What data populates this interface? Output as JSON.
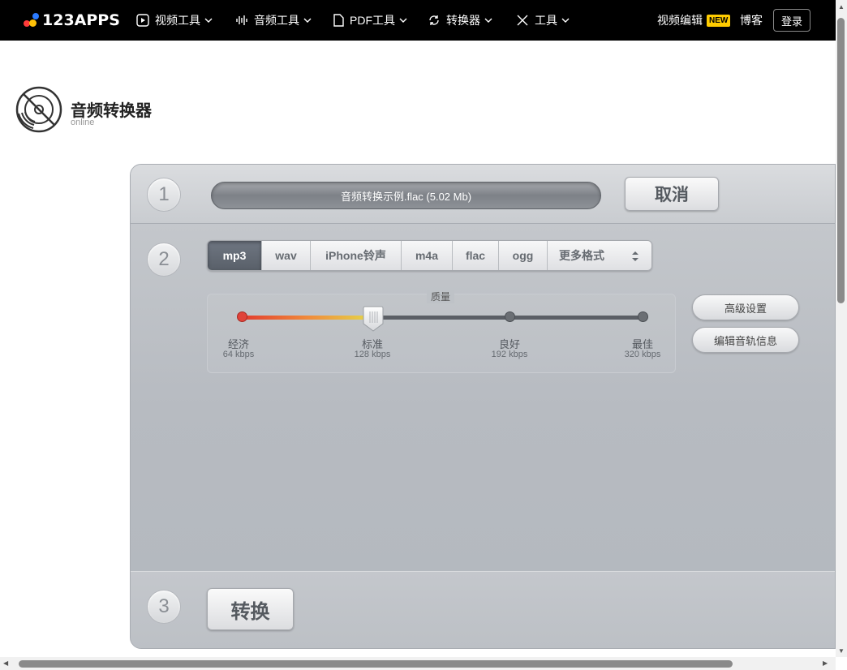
{
  "nav": {
    "logo": "123APPS",
    "items": [
      {
        "label": "视频工具",
        "icon": "play-icon"
      },
      {
        "label": "音频工具",
        "icon": "waveform-icon"
      },
      {
        "label": "PDF工具",
        "icon": "document-icon"
      },
      {
        "label": "转换器",
        "icon": "convert-icon"
      },
      {
        "label": "工具",
        "icon": "tools-icon"
      }
    ],
    "video_editor": "视频编辑",
    "new_badge": "NEW",
    "blog": "博客",
    "login": "登录"
  },
  "app": {
    "title": "音频转换器",
    "subtitle": "online"
  },
  "steps": {
    "s1": "1",
    "s2": "2",
    "s3": "3"
  },
  "file": {
    "name": "音频转换示例.flac (5.02 Mb)",
    "cancel_label": "取消"
  },
  "formats": {
    "items": [
      "mp3",
      "wav",
      "iPhone铃声",
      "m4a",
      "flac",
      "ogg",
      "更多格式"
    ],
    "selected": "mp3"
  },
  "quality": {
    "label": "质量",
    "levels": [
      {
        "name": "经济",
        "rate": "64 kbps"
      },
      {
        "name": "标准",
        "rate": "128 kbps"
      },
      {
        "name": "良好",
        "rate": "192 kbps"
      },
      {
        "name": "最佳",
        "rate": "320 kbps"
      }
    ],
    "selected_index": 1
  },
  "settings": {
    "advanced": "高级设置",
    "edit_track_info": "编辑音轨信息"
  },
  "convert_label": "转换",
  "colors": {
    "nav_bg": "#000000",
    "new_badge": "#ffcc00",
    "active_format": "#5f6670"
  }
}
